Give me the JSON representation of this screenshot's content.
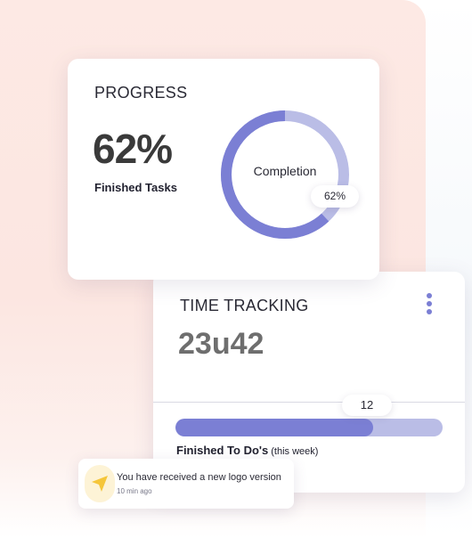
{
  "colors": {
    "accent": "#7b7fd4",
    "accent_light": "#babde6",
    "notification_icon": "#f5c63a"
  },
  "progress": {
    "title": "PROGRESS",
    "value": "62%",
    "subtitle": "Finished Tasks",
    "donut_center_label": "Completion",
    "donut_badge": "62%",
    "completion_fraction": 0.62
  },
  "time_tracking": {
    "title": "TIME TRACKING",
    "value": "23u42",
    "menu_icon": "vertical-dots-icon",
    "bar_badge": "12",
    "bar_fraction": 0.74,
    "bar_label": "Finished To Do's",
    "bar_label_suffix": "(this week)"
  },
  "notification": {
    "icon": "send-arrow-icon",
    "message": "You have received a new logo version",
    "time": "10 min ago"
  }
}
